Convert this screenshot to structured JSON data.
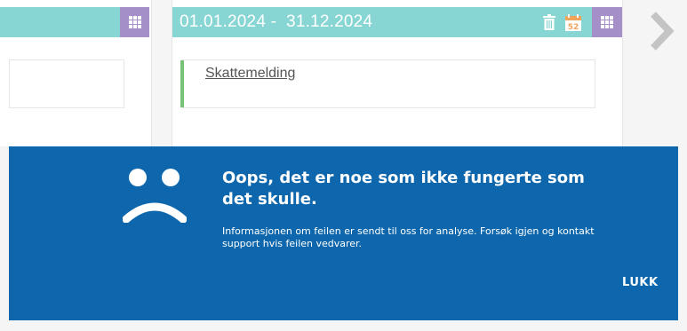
{
  "cards": {
    "previous": {
      "grid_icon": "grid-icon"
    },
    "current": {
      "period": "01.01.2024 -  31.12.2024",
      "document_link": "Skattemelding",
      "icons": [
        "trash-icon",
        "calendar-52-icon",
        "grid-icon"
      ],
      "calendar_badge": "52"
    }
  },
  "navigation": {
    "next_icon": "chevron-right-icon"
  },
  "error_banner": {
    "title": "Oops, det er noe som ikke fungerte som det skulle.",
    "message": "Informasjonen om feilen er sendt til oss for analyse. Forsøk igjen og kontakt support hvis feilen vedvarer.",
    "close_label": "LUKK",
    "icon": "sad-face-icon"
  },
  "colors": {
    "header_teal": "#88d6d3",
    "grid_button_purple": "#a48fc8",
    "banner_blue": "#0e67ac",
    "accent_green": "#77c17a",
    "calendar_orange": "#f0a35a"
  }
}
